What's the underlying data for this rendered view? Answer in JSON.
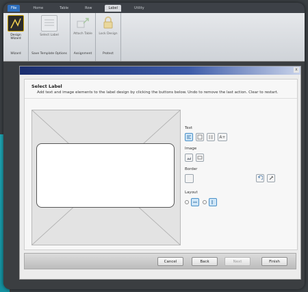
{
  "ribbon": {
    "tabs": [
      {
        "label": "File"
      },
      {
        "label": "Home"
      },
      {
        "label": "Table"
      },
      {
        "label": "Row"
      },
      {
        "label": "Label"
      },
      {
        "label": "Utility"
      }
    ],
    "groups": [
      {
        "label": "Wizard",
        "buttons": [
          {
            "label": "Design Wizard"
          }
        ]
      },
      {
        "label": "Save Template Options",
        "buttons": [
          {
            "label": "Select Label"
          }
        ]
      },
      {
        "label": "Assignment",
        "buttons": [
          {
            "label": "Attach Table"
          }
        ]
      },
      {
        "label": "Protect",
        "buttons": [
          {
            "label": "Lock Design"
          }
        ]
      }
    ]
  },
  "dialog": {
    "close_glyph": "x",
    "title": "Select Label",
    "description": "Add text and image elements to the label design by clicking the buttons below. Undo to remove the last action. Clear to restart.",
    "sections": {
      "text": "Text",
      "image": "Image",
      "border": "Border",
      "layout": "Layout"
    },
    "text_buttons": {
      "fit": "A+"
    },
    "buttons": {
      "cancel": "Cancel",
      "back": "Back",
      "next": "Next",
      "finish": "Finish"
    }
  },
  "colors": {
    "ribbon_file_tab": "#2f6fbe",
    "title_gradient_start": "#1a2d6e",
    "selected_button": "#cfe6f7",
    "accent_edge": "#1fa6b4"
  }
}
